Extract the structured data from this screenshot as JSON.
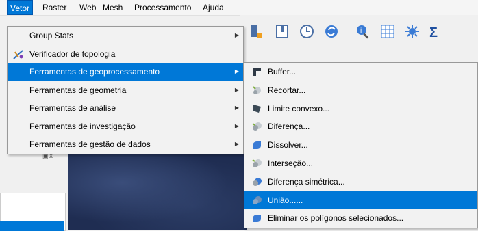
{
  "menubar": {
    "items": [
      {
        "label": "Vetor"
      },
      {
        "label": "Raster"
      },
      {
        "label": "Web"
      },
      {
        "label": "Mesh"
      },
      {
        "label": "Processamento"
      },
      {
        "label": "Ajuda"
      }
    ]
  },
  "vector_menu": {
    "items": [
      {
        "label": "Group Stats",
        "submenu": true
      },
      {
        "label": "Verificador de topologia",
        "icon": "topology-checker-icon"
      },
      {
        "label": "Ferramentas de geoprocessamento",
        "submenu": true,
        "highlighted": true
      },
      {
        "label": "Ferramentas de geometria",
        "submenu": true
      },
      {
        "label": "Ferramentas de análise",
        "submenu": true
      },
      {
        "label": "Ferramentas de investigação",
        "submenu": true
      },
      {
        "label": "Ferramentas de gestão de dados",
        "submenu": true
      }
    ]
  },
  "geoprocessing_submenu": {
    "items": [
      {
        "label": "Buffer...",
        "icon": "buffer-icon"
      },
      {
        "label": "Recortar...",
        "icon": "clip-icon"
      },
      {
        "label": "Limite convexo...",
        "icon": "convex-hull-icon"
      },
      {
        "label": "Diferença...",
        "icon": "difference-icon"
      },
      {
        "label": "Dissolver...",
        "icon": "dissolve-icon"
      },
      {
        "label": "Interseção...",
        "icon": "intersection-icon"
      },
      {
        "label": "Diferença simétrica...",
        "icon": "symmetrical-difference-icon"
      },
      {
        "label": "União......",
        "icon": "union-icon",
        "highlighted": true
      },
      {
        "label": "Eliminar os polígonos selecionados...",
        "icon": "eliminate-icon"
      }
    ]
  },
  "colors": {
    "highlight": "#0078d7",
    "menu_bg": "#f2f2f2"
  }
}
